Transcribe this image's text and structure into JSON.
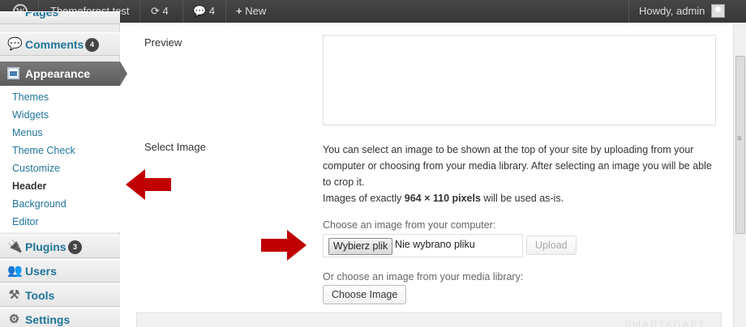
{
  "adminbar": {
    "site_name": "Themeforest test",
    "updates_count": "4",
    "comments_count": "4",
    "new_label": "New",
    "greeting": "Howdy, admin"
  },
  "sidebar": {
    "pages_label": "Pages",
    "comments_label": "Comments",
    "comments_badge": "4",
    "appearance_label": "Appearance",
    "submenu": [
      "Themes",
      "Widgets",
      "Menus",
      "Theme Check",
      "Customize",
      "Header",
      "Background",
      "Editor"
    ],
    "current_submenu": "Header",
    "plugins_label": "Plugins",
    "plugins_badge": "3",
    "users_label": "Users",
    "tools_label": "Tools",
    "settings_label": "Settings"
  },
  "main": {
    "preview_label": "Preview",
    "select_image_label": "Select Image",
    "description_line1": "You can select an image to be shown at the top of your site by uploading from your",
    "description_line2": "computer or choosing from your media library. After selecting an image you will be able",
    "description_line3": "to crop it.",
    "size_prefix": "Images of exactly ",
    "size_value": "964 × 110 pixels",
    "size_suffix": " will be used as-is.",
    "upload_prompt": "Choose an image from your computer:",
    "file_button": "Wybierz plik",
    "file_status": "Nie wybrano pliku",
    "upload_button": "Upload",
    "library_prompt": "Or choose an image from your media library:",
    "choose_image_button": "Choose Image"
  },
  "watermark": "SMARTADAPT",
  "colors": {
    "adminbar_bg": "#464646",
    "link": "#21759b",
    "arrow": "#c00000"
  }
}
